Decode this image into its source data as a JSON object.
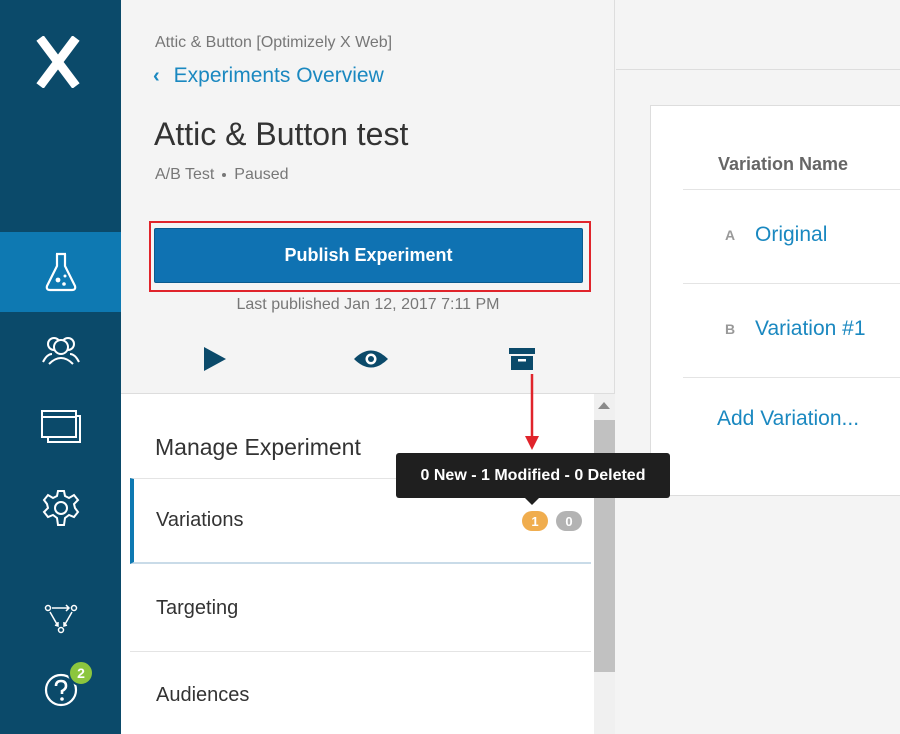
{
  "nav": {
    "help_badge": "2",
    "active_item": "experiments"
  },
  "header": {
    "project": "Attic & Button [Optimizely X Web]",
    "back_link": "Experiments Overview",
    "title": "Attic & Button test",
    "type": "A/B Test",
    "status": "Paused"
  },
  "publish": {
    "button_label": "Publish Experiment",
    "last_published": "Last published Jan 12, 2017 7:11 PM"
  },
  "manage": {
    "title": "Manage Experiment",
    "items": [
      {
        "label": "Variations"
      },
      {
        "label": "Targeting"
      },
      {
        "label": "Audiences"
      }
    ],
    "variations_badges": {
      "modified": "1",
      "deleted": "0"
    }
  },
  "tooltip": {
    "text": "0 New - 1 Modified - 0 Deleted"
  },
  "variations_table": {
    "column_header": "Variation Name",
    "rows": [
      {
        "letter": "A",
        "name": "Original"
      },
      {
        "letter": "B",
        "name": "Variation #1"
      }
    ],
    "add_link": "Add Variation..."
  },
  "colors": {
    "nav_bg": "#0b4a6a",
    "nav_active": "#0e79b2",
    "primary_button": "#0f72b2",
    "link": "#1a88c0",
    "annotation_red": "#e0242b",
    "badge_modified": "#f0ad4e",
    "badge_deleted": "#b3b3b3",
    "help_badge": "#8cc63e"
  }
}
